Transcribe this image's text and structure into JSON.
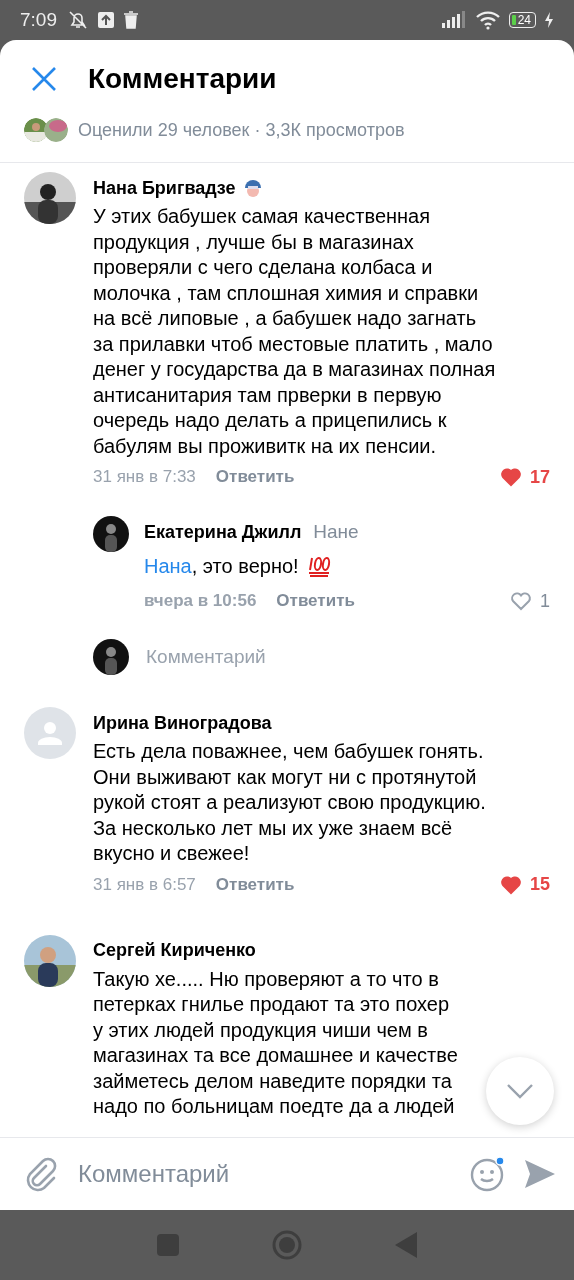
{
  "status_bar": {
    "time": "7:09",
    "battery": "24"
  },
  "header": {
    "title": "Комментарии",
    "stats": "Оценили 29 человек · 3,3К просмотров"
  },
  "comments": [
    {
      "author": "Нана Бригвадзе",
      "badge": true,
      "lines": [
        "У этих бабушек самая качественная",
        "продукция , лучше бы в магазинах",
        "проверяли с чего сделана колбаса и",
        "молочка , там сплошная химия и справки",
        "на всё липовые , а бабушек надо загнать",
        "за прилавки чтоб местовые платить , мало",
        "денег у государства да в магазинах полная",
        "антисанитария там прверки в первую",
        "очередь надо делать а прицепились к",
        "бабулям вы проживитк на их пенсии."
      ],
      "date": "31 янв в 7:33",
      "reply": "Ответить",
      "likes": "17",
      "liked": true,
      "children": [
        {
          "author": "Екатерина Джилл",
          "reply_to": "Нане",
          "mention": "Нана",
          "text": ", это верно!",
          "hundred": true,
          "date": "вчера в 10:56",
          "reply": "Ответить",
          "likes": "1",
          "liked": false
        }
      ],
      "reply_placeholder": "Комментарий"
    },
    {
      "author": "Ирина Виноградова",
      "badge": false,
      "avatar": {
        "kind": "placeholder"
      },
      "lines": [
        "Есть дела поважнее, чем бабушек гонять.",
        "Они выживают как могут ни с протянутой",
        "рукой стоят а реализуют свою продукцию.",
        "За несколько лет мы их уже знаем  всё",
        "вкусно и свежее!"
      ],
      "date": "31 янв в 6:57",
      "reply": "Ответить",
      "likes": "15",
      "liked": true
    },
    {
      "author": "Сергей Кириченко",
      "badge": false,
      "lines": [
        "Такую хе..... Ню проверяют а то что в",
        "петерках гнилье продают та это похер",
        "у этих людей продукция чиши чем в",
        "магазинах та все домашнее и качестве",
        "займетесь делом наведите порядки та",
        "надо по больницам поедте да а людей"
      ]
    }
  ],
  "composer": {
    "placeholder": "Комментарий",
    "emoji_notification": true
  }
}
